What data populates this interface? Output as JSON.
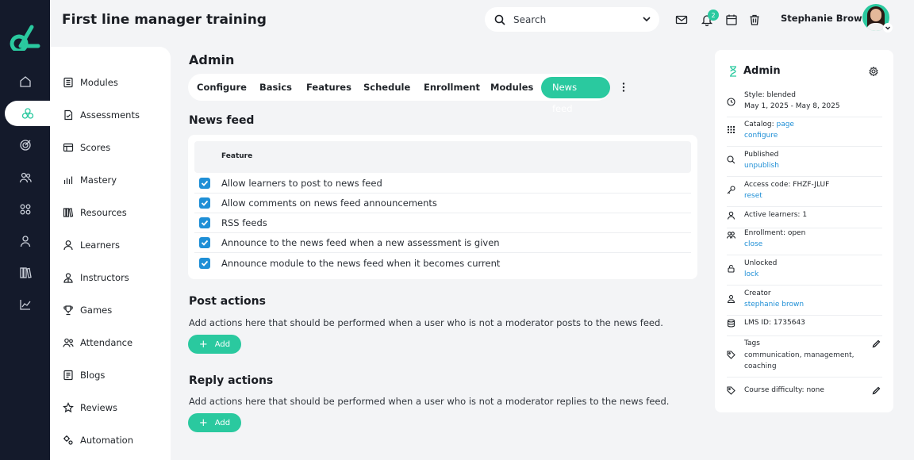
{
  "app": {
    "title": "First line manager training"
  },
  "search": {
    "placeholder": "Search"
  },
  "notifications": {
    "count": "2"
  },
  "user": {
    "name": "Stephanie Brown"
  },
  "rail": {
    "items": [
      "home-icon",
      "assessments-icon",
      "target-icon",
      "users-icon",
      "grid-icon",
      "person-icon",
      "books-icon",
      "chart-icon"
    ],
    "active": 1
  },
  "subnav": {
    "items": [
      {
        "label": "Modules",
        "icon": "modules-icon"
      },
      {
        "label": "Assessments",
        "icon": "assessments-icon"
      },
      {
        "label": "Scores",
        "icon": "scores-icon"
      },
      {
        "label": "Mastery",
        "icon": "mastery-icon"
      },
      {
        "label": "Resources",
        "icon": "resources-icon"
      },
      {
        "label": "Learners",
        "icon": "learners-icon"
      },
      {
        "label": "Instructors",
        "icon": "instructors-icon"
      },
      {
        "label": "Games",
        "icon": "games-icon"
      },
      {
        "label": "Attendance",
        "icon": "attendance-icon"
      },
      {
        "label": "Blogs",
        "icon": "blogs-icon"
      },
      {
        "label": "Reviews",
        "icon": "reviews-icon"
      },
      {
        "label": "Automation",
        "icon": "automation-icon"
      }
    ]
  },
  "main": {
    "title": "Admin",
    "tabs": [
      {
        "label": "Configure"
      },
      {
        "label": "Basics"
      },
      {
        "label": "Features"
      },
      {
        "label": "Schedule"
      },
      {
        "label": "Enrollment"
      },
      {
        "label": "Modules"
      },
      {
        "label": "News feed",
        "active": true
      }
    ],
    "news_feed": {
      "title": "News feed",
      "column_header": "Feature",
      "features": [
        {
          "label": "Allow learners to post to news feed",
          "checked": true
        },
        {
          "label": "Allow comments on news feed announcements",
          "checked": true
        },
        {
          "label": "RSS feeds",
          "checked": true
        },
        {
          "label": "Announce to the news feed when a new assessment is given",
          "checked": true
        },
        {
          "label": "Announce module to the news feed when it becomes current",
          "checked": true
        }
      ]
    },
    "post_actions": {
      "title": "Post actions",
      "description": "Add actions here that should be performed when a user who is not a moderator posts to the news feed.",
      "add_label": "Add"
    },
    "reply_actions": {
      "title": "Reply actions",
      "description": "Add actions here that should be performed when a user who is not a moderator replies to the news feed.",
      "add_label": "Add"
    }
  },
  "panel": {
    "title": "Admin",
    "style": "Style: blended",
    "dates": "May 1, 2025 - May 8, 2025",
    "catalog_label": "Catalog:",
    "catalog_link": "page",
    "catalog_action": "configure",
    "published": "Published",
    "unpublish": "unpublish",
    "access_code": "Access code: FHZF-JLUF",
    "reset": "reset",
    "active_learners": "Active learners: 1",
    "enrollment": "Enrollment: open",
    "close": "close",
    "unlocked": "Unlocked",
    "lock": "lock",
    "creator_label": "Creator",
    "creator": "stephanie brown",
    "lms_id": "LMS ID: 1735643",
    "tags_label": "Tags",
    "tags_line1": "communication, management,",
    "tags_line2": "coaching",
    "difficulty": "Course difficulty: none"
  },
  "colors": {
    "accent": "#2ac99f",
    "rail": "#141a2b",
    "link": "#1f8fd6",
    "background": "#f3f4f6"
  }
}
